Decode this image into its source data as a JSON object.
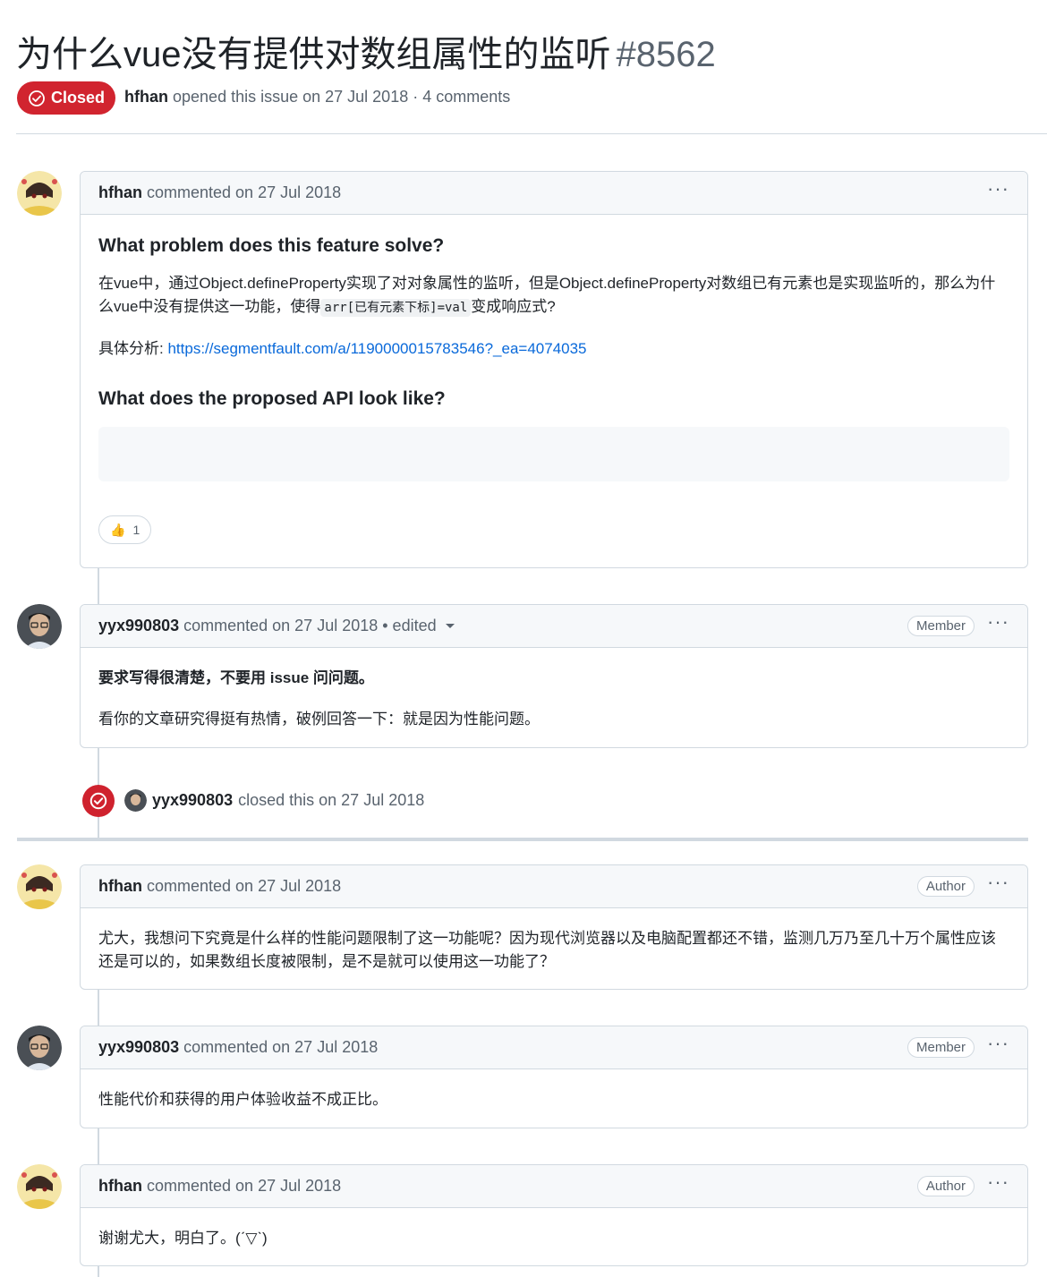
{
  "issue": {
    "title": "为什么vue没有提供对数组属性的监听",
    "number": "#8562",
    "state_label": "Closed",
    "author": "hfhan",
    "meta_text": "opened this issue on 27 Jul 2018 · 4 comments"
  },
  "comments": [
    {
      "author": "hfhan",
      "meta": "commented on 27 Jul 2018",
      "h1": "What problem does this feature solve?",
      "p1_before": "在vue中，通过Object.defineProperty实现了对对象属性的监听，但是Object.defineProperty对数组已有元素也是实现监听的，那么为什么vue中没有提供这一功能，使得",
      "p1_code": "arr[已有元素下标]=val",
      "p1_after": "变成响应式?",
      "analysis_label": "具体分析:",
      "analysis_link": "https://segmentfault.com/a/1190000015783546?_ea=4074035",
      "h2": "What does the proposed API look like?",
      "reaction_emoji": "👍",
      "reaction_count": "1"
    },
    {
      "author": "yyx990803",
      "meta": "commented on 27 Jul 2018 • edited",
      "role": "Member",
      "bold_line": "要求写得很清楚，不要用 issue 问问题。",
      "line2": "看你的文章研究得挺有热情，破例回答一下：就是因为性能问题。"
    },
    {
      "author": "hfhan",
      "meta": "commented on 27 Jul 2018",
      "role": "Author",
      "text": "尤大，我想问下究竟是什么样的性能问题限制了这一功能呢？因为现代浏览器以及电脑配置都还不错，监测几万乃至几十万个属性应该还是可以的，如果数组长度被限制，是不是就可以使用这一功能了？"
    },
    {
      "author": "yyx990803",
      "meta": "commented on 27 Jul 2018",
      "role": "Member",
      "text": "性能代价和获得的用户体验收益不成正比。"
    },
    {
      "author": "hfhan",
      "meta": "commented on 27 Jul 2018",
      "role": "Author",
      "text": "谢谢尤大，明白了。(ˊ▽ˋ)"
    }
  ],
  "event": {
    "actor": "yyx990803",
    "text": "closed this on 27 Jul 2018"
  },
  "menu_dots": "···",
  "colors": {
    "closed_red": "#d1242f",
    "link_blue": "#0969da",
    "border": "#d1d9e0"
  }
}
